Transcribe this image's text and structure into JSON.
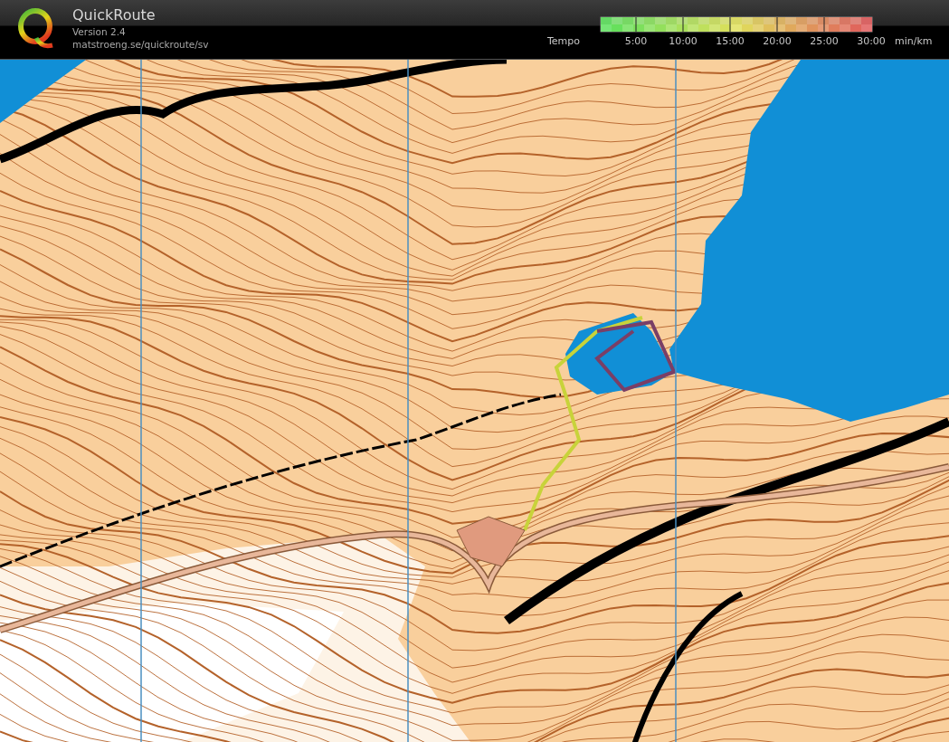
{
  "app": {
    "title": "QuickRoute",
    "version": "Version 2.4",
    "url": "matstroeng.se/quickroute/sv"
  },
  "tempo_scale": {
    "label": "Tempo",
    "ticks": [
      "5:00",
      "10:00",
      "15:00",
      "20:00",
      "25:00",
      "30:00"
    ],
    "unit": "min/km"
  }
}
